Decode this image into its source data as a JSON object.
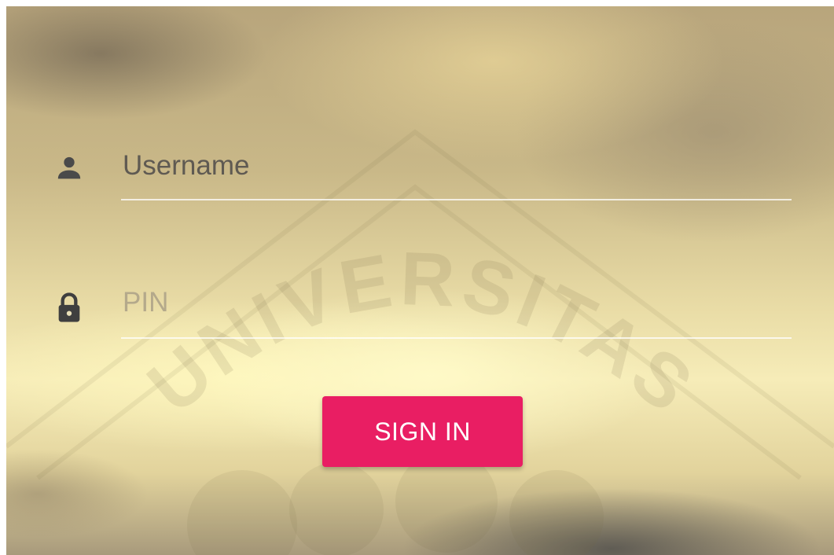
{
  "login_form": {
    "username": {
      "value": "",
      "placeholder": "Username",
      "icon": "person-icon"
    },
    "pin": {
      "value": "",
      "placeholder": "PIN",
      "icon": "lock-icon"
    },
    "submit_label": "SIGN IN"
  },
  "watermark": {
    "text": "UNIVERSITAS"
  },
  "colors": {
    "accent": "#e91e63",
    "icon": "#4a4a4a",
    "underline": "#f2eee0"
  }
}
